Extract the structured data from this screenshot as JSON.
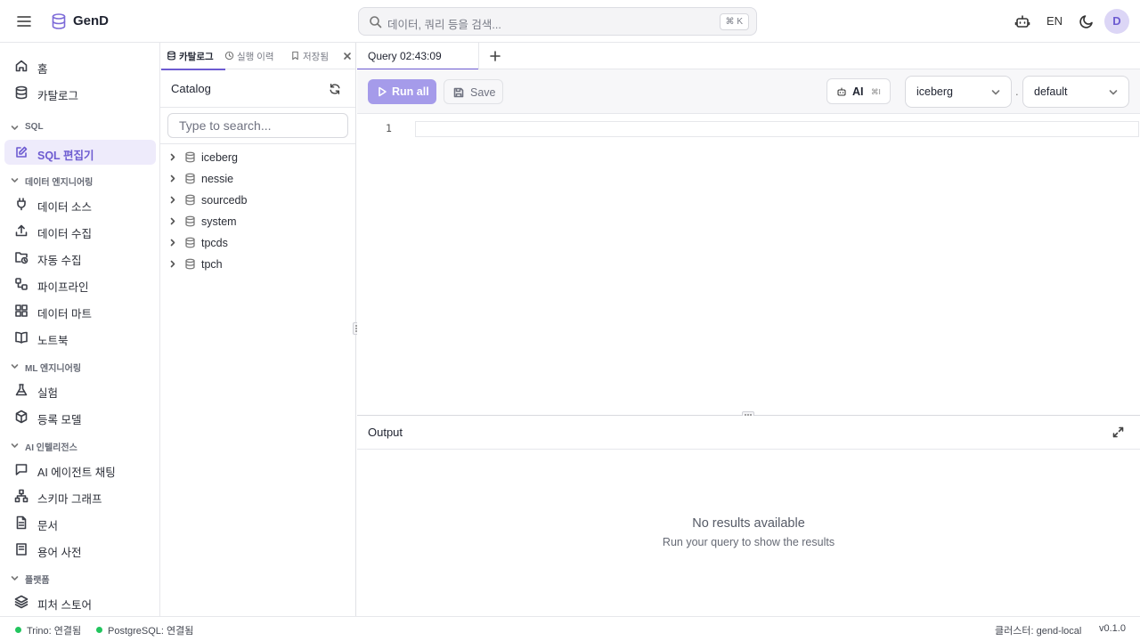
{
  "app": {
    "brand": "GenD",
    "accent": "#6d5bd1"
  },
  "header": {
    "search_placeholder": "데이터, 쿼리 등을 검색...",
    "search_shortcut": "⌘ K",
    "language": "EN",
    "avatar_initial": "D"
  },
  "sidebar": {
    "home": "홈",
    "catalog": "카탈로그",
    "sections": {
      "sql": "SQL",
      "data_eng": "데이터 엔지니어링",
      "ml_eng": "ML 엔지니어링",
      "ai_intel": "AI 인텔리전스",
      "platform": "플랫폼"
    },
    "items": {
      "sql_editor": "SQL 편집기",
      "data_sources": "데이터 소스",
      "data_ingestion": "데이터 수집",
      "auto_ingestion": "자동 수집",
      "pipeline": "파이프라인",
      "data_mart": "데이터 마트",
      "notebook": "노트북",
      "experiments": "실험",
      "registered_models": "등록 모델",
      "ai_agent_chat": "AI 에이전트 채팅",
      "schema_graph": "스키마 그래프",
      "documents": "문서",
      "glossary": "용어 사전",
      "feature_store": "피처 스토어"
    }
  },
  "catalog_panel": {
    "tabs": [
      "카탈로그",
      "실행 이력",
      "저장됨"
    ],
    "title": "Catalog",
    "search_placeholder": "Type to search...",
    "nodes": [
      "iceberg",
      "nessie",
      "sourcedb",
      "system",
      "tpcds",
      "tpch"
    ]
  },
  "editor": {
    "query_tab": "Query 02:43:09",
    "run_all": "Run all",
    "save": "Save",
    "ai": "AI",
    "ai_shortcut": "⌘I",
    "catalog_select": "iceberg",
    "separator": ".",
    "schema_select": "default",
    "line_number": "1"
  },
  "output": {
    "title": "Output",
    "empty_title": "No results available",
    "empty_subtitle": "Run your query to show the results"
  },
  "status": {
    "trino": "Trino: 연결됨",
    "postgres": "PostgreSQL: 연결됨",
    "cluster": "클러스터: gend-local",
    "version": "v0.1.0",
    "connected_color": "#22c55e"
  }
}
